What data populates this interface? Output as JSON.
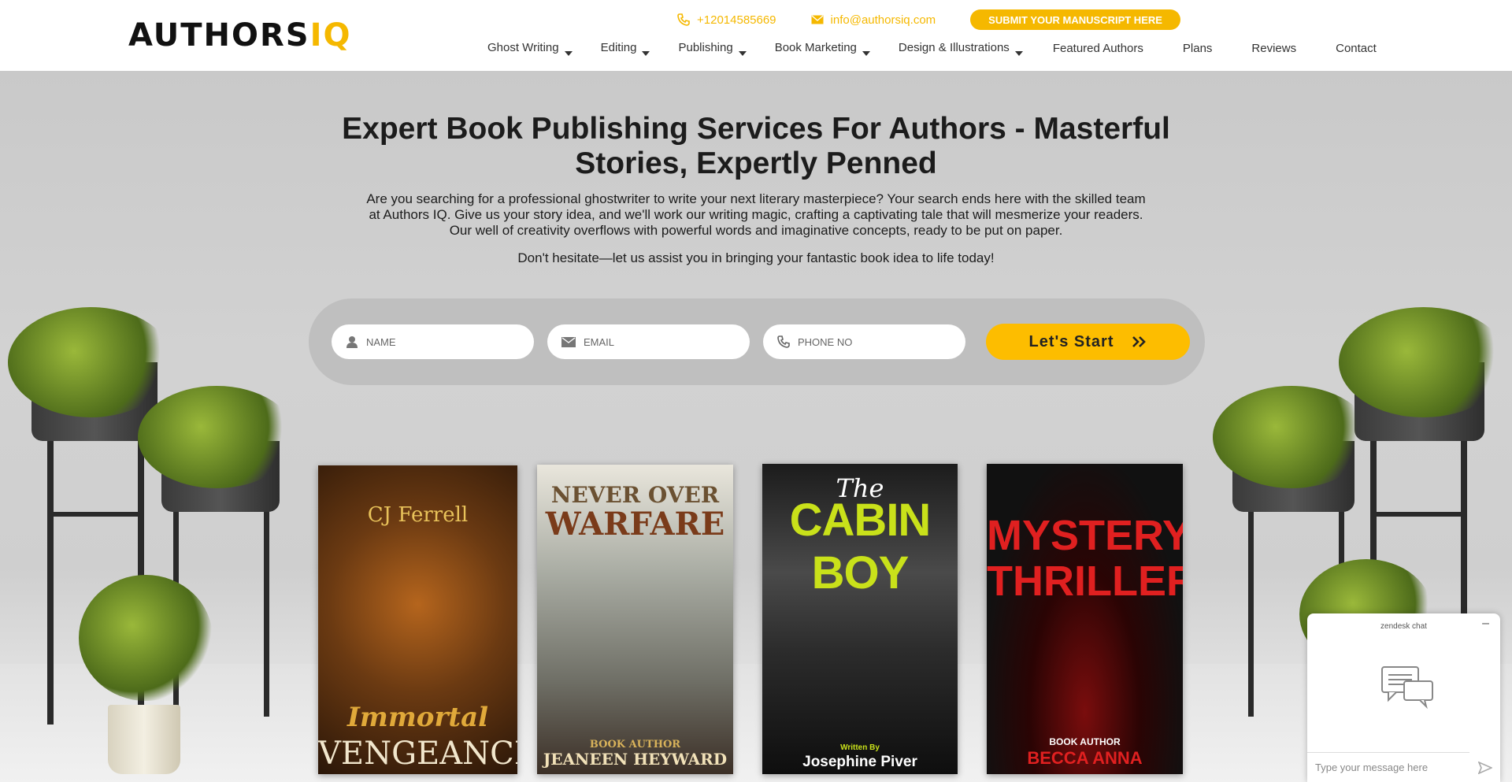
{
  "brand": {
    "logo_main": "AUTHORS",
    "logo_accent": "IQ",
    "accent_color": "#f5b800"
  },
  "topbar": {
    "phone": "+12014585669",
    "email": "info@authorsiq.com",
    "submit_label": "SUBMIT YOUR MANUSCRIPT HERE"
  },
  "nav": {
    "items": [
      {
        "label": "Ghost Writing",
        "dropdown": true
      },
      {
        "label": "Editing",
        "dropdown": true
      },
      {
        "label": "Publishing",
        "dropdown": true
      },
      {
        "label": "Book Marketing",
        "dropdown": true
      },
      {
        "label": "Design & Illustrations",
        "dropdown": true
      },
      {
        "label": "Featured Authors",
        "dropdown": false
      },
      {
        "label": "Plans",
        "dropdown": false
      },
      {
        "label": "Reviews",
        "dropdown": false
      },
      {
        "label": "Contact",
        "dropdown": false
      }
    ]
  },
  "hero": {
    "title": "Expert Book Publishing Services For Authors - Masterful Stories, Expertly Penned",
    "description": "Are you searching for a professional ghostwriter to write your next literary masterpiece? Your search ends here with the skilled team at Authors IQ. Give us your story idea, and we'll work our writing magic, crafting a captivating tale that will mesmerize your readers. Our well of creativity overflows with powerful words and imaginative concepts, ready to be put on paper.",
    "cta_line": "Don't hesitate—let us assist you in bringing your fantastic book idea to life today!"
  },
  "form": {
    "name_placeholder": "NAME",
    "email_placeholder": "EMAIL",
    "phone_placeholder": "PHONE NO",
    "submit_label": "Let's Start"
  },
  "books": [
    {
      "author_top": "CJ Ferrell",
      "title_line1": "Immortal",
      "title_line2": "VENGEANCE"
    },
    {
      "title_line1": "NEVER OVER",
      "title_line2": "WARFARE",
      "author_caption": "BOOK AUTHOR",
      "author": "JEANEEN HEYWARD"
    },
    {
      "title_small": "The",
      "title_line1": "CABIN BOY",
      "author_caption": "Written By",
      "author": "Josephine Piver"
    },
    {
      "title_line1": "MYSTERY",
      "title_line2": "THRILLER",
      "author_caption": "BOOK AUTHOR",
      "author": "BECCA ANNA"
    }
  ],
  "chat": {
    "title": "zendesk chat",
    "minimize": "–",
    "input_placeholder": "Type your message here"
  }
}
